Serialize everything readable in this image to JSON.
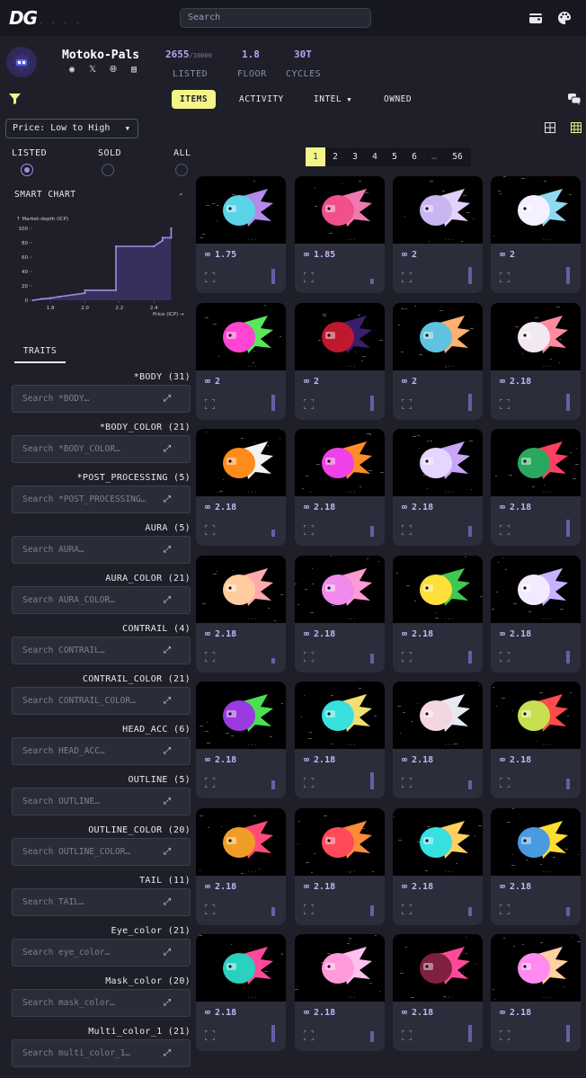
{
  "header": {
    "logo": "DG",
    "logo_dots": ". . . .",
    "search_placeholder": "Search"
  },
  "collection": {
    "name": "Motoko-Pals",
    "stats": [
      {
        "value": "2655",
        "sub": "/10000",
        "label": "LISTED"
      },
      {
        "value": "1.8",
        "sub": "",
        "label": "FLOOR"
      },
      {
        "value": "30T",
        "sub": "",
        "label": "CYCLES"
      }
    ]
  },
  "nav": {
    "tabs": [
      {
        "label": "ITEMS",
        "active": true
      },
      {
        "label": "ACTIVITY",
        "active": false
      },
      {
        "label": "INTEL",
        "active": false
      },
      {
        "label": "OWNED",
        "active": false
      }
    ]
  },
  "sort": {
    "selected": "Price: Low to High"
  },
  "listing_filter": {
    "options": [
      {
        "label": "LISTED",
        "selected": true
      },
      {
        "label": "SOLD",
        "selected": false
      },
      {
        "label": "ALL",
        "selected": false
      }
    ]
  },
  "smart_chart": {
    "title": "SMART CHART",
    "collapse": "-",
    "ylabel": "↑ Market-depth (ICP)",
    "xlabel": "Price (ICP) →",
    "yticks": [
      "100",
      "80",
      "60",
      "40",
      "20",
      "0"
    ],
    "xticks": [
      "1.8",
      "2.0",
      "2.2",
      "2.4"
    ]
  },
  "chart_data": {
    "type": "line",
    "ylabel": "Market-depth (ICP)",
    "xlabel": "Price (ICP)",
    "x": [
      1.7,
      1.75,
      1.8,
      1.85,
      2.0,
      2.0,
      2.18,
      2.18,
      2.4,
      2.45,
      2.45,
      2.5,
      2.5
    ],
    "y": [
      0,
      2,
      3,
      5,
      10,
      14,
      14,
      75,
      75,
      83,
      87,
      87,
      100
    ],
    "xlim": [
      1.7,
      2.55
    ],
    "ylim": [
      0,
      100
    ]
  },
  "traits": {
    "tab_label": "TRAITS",
    "items": [
      {
        "label": "*BODY (31)",
        "placeholder": "Search *BODY…"
      },
      {
        "label": "*BODY_COLOR (21)",
        "placeholder": "Search *BODY_COLOR…"
      },
      {
        "label": "*POST_PROCESSING (5)",
        "placeholder": "Search *POST_PROCESSING…"
      },
      {
        "label": "AURA (5)",
        "placeholder": "Search AURA…"
      },
      {
        "label": "AURA_COLOR (21)",
        "placeholder": "Search AURA_COLOR…"
      },
      {
        "label": "CONTRAIL (4)",
        "placeholder": "Search CONTRAIL…"
      },
      {
        "label": "CONTRAIL_COLOR (21)",
        "placeholder": "Search CONTRAIL_COLOR…"
      },
      {
        "label": "HEAD_ACC (6)",
        "placeholder": "Search HEAD_ACC…"
      },
      {
        "label": "OUTLINE (5)",
        "placeholder": "Search OUTLINE…"
      },
      {
        "label": "OUTLINE_COLOR (20)",
        "placeholder": "Search OUTLINE_COLOR…"
      },
      {
        "label": "TAIL (11)",
        "placeholder": "Search TAIL…"
      },
      {
        "label": "Eye_color (21)",
        "placeholder": "Search eye_color…"
      },
      {
        "label": "Mask_color (20)",
        "placeholder": "Search mask_color…"
      },
      {
        "label": "Multi_color_1 (21)",
        "placeholder": "Search multi_color_1…"
      }
    ]
  },
  "pagination": {
    "pages": [
      "1",
      "2",
      "3",
      "4",
      "5",
      "6",
      "…",
      "56"
    ],
    "current": "1"
  },
  "price_symbol": "∞",
  "items": [
    {
      "price": "1.75",
      "body": "#5ad4e6",
      "tail": "#b58be8",
      "bar": 0.75
    },
    {
      "price": "1.85",
      "body": "#f0508c",
      "tail": "#f07ab0",
      "bar": 0.25
    },
    {
      "price": "2",
      "body": "#c9b5f2",
      "tail": "#e2d2fb",
      "bar": 0.85
    },
    {
      "price": "2",
      "body": "#f4f0ff",
      "tail": "#8ed8f0",
      "bar": 0.85
    },
    {
      "price": "2",
      "body": "#ff45d2",
      "tail": "#58e858",
      "bar": 0.8
    },
    {
      "price": "2",
      "body": "#c0182e",
      "tail": "#3a1d6b",
      "bar": 0.75
    },
    {
      "price": "2",
      "body": "#5fc2e0",
      "tail": "#ffb070",
      "bar": 0.85
    },
    {
      "price": "2.18",
      "body": "#f2e8f2",
      "tail": "#ff8aa0",
      "bar": 0.85
    },
    {
      "price": "2.18",
      "body": "#ff8c1a",
      "tail": "#f2f2f2",
      "bar": 0.35
    },
    {
      "price": "2.18",
      "body": "#f040e8",
      "tail": "#ff8c28",
      "bar": 0.55
    },
    {
      "price": "2.18",
      "body": "#e6d5ff",
      "tail": "#c8a6f7",
      "bar": 0.55
    },
    {
      "price": "2.18",
      "body": "#2aa860",
      "tail": "#ff4060",
      "bar": 0.85
    },
    {
      "price": "2.18",
      "body": "#ffcc9e",
      "tail": "#ffa9ad",
      "bar": 0.25
    },
    {
      "price": "2.18",
      "body": "#f08aec",
      "tail": "#ff9ad2",
      "bar": 0.5
    },
    {
      "price": "2.18",
      "body": "#ffdf3a",
      "tail": "#40c850",
      "bar": 0.65
    },
    {
      "price": "2.18",
      "body": "#f3eaff",
      "tail": "#c6b2ff",
      "bar": 0.65
    },
    {
      "price": "2.18",
      "body": "#9a3ae0",
      "tail": "#4ce050",
      "bar": 0.45
    },
    {
      "price": "2.18",
      "body": "#38e0e0",
      "tail": "#f0e070",
      "bar": 0.85
    },
    {
      "price": "2.18",
      "body": "#f4d6e0",
      "tail": "#e8e8f0",
      "bar": 0.45
    },
    {
      "price": "2.18",
      "body": "#c6e050",
      "tail": "#ff4a4a",
      "bar": 0.55
    },
    {
      "price": "2.18",
      "body": "#f09d28",
      "tail": "#ff4a7a",
      "bar": 0.45
    },
    {
      "price": "2.18",
      "body": "#ff4a5a",
      "tail": "#ff8a3a",
      "bar": 0.55
    },
    {
      "price": "2.18",
      "body": "#38e0e0",
      "tail": "#ffd060",
      "bar": 0.45
    },
    {
      "price": "2.18",
      "body": "#4a9ae0",
      "tail": "#ffdd33",
      "bar": 0.45
    },
    {
      "price": "2.18",
      "body": "#2ad0c0",
      "tail": "#ff4a9a",
      "bar": 0.85
    },
    {
      "price": "2.18",
      "body": "#ff9ad8",
      "tail": "#ffc0f0",
      "bar": 0.55
    },
    {
      "price": "2.18",
      "body": "#802040",
      "tail": "#ff4a9a",
      "bar": 0.85
    },
    {
      "price": "2.18",
      "body": "#ff8af0",
      "tail": "#ffd0a0",
      "bar": 0.85
    }
  ]
}
